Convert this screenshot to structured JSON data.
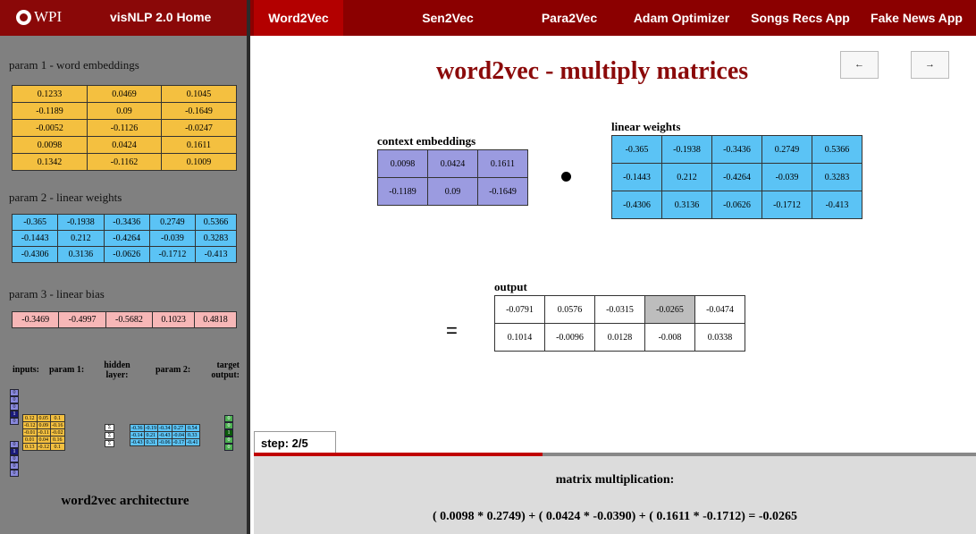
{
  "nav": {
    "logo": "WPI",
    "home": "visNLP 2.0 Home",
    "items": [
      "Word2Vec",
      "Sen2Vec",
      "Para2Vec",
      "Adam Optimizer",
      "Songs Recs App",
      "Fake News App"
    ],
    "active": "Word2Vec"
  },
  "sidebar": {
    "param1_label": "param 1 - word embeddings",
    "param1": [
      [
        "0.1233",
        "0.0469",
        "0.1045"
      ],
      [
        "-0.1189",
        "0.09",
        "-0.1649"
      ],
      [
        "-0.0052",
        "-0.1126",
        "-0.0247"
      ],
      [
        "0.0098",
        "0.0424",
        "0.1611"
      ],
      [
        "0.1342",
        "-0.1162",
        "0.1009"
      ]
    ],
    "param2_label": "param 2 - linear weights",
    "param2": [
      [
        "-0.365",
        "-0.1938",
        "-0.3436",
        "0.2749",
        "0.5366"
      ],
      [
        "-0.1443",
        "0.212",
        "-0.4264",
        "-0.039",
        "0.3283"
      ],
      [
        "-0.4306",
        "0.3136",
        "-0.0626",
        "-0.1712",
        "-0.413"
      ]
    ],
    "param3_label": "param 3 - linear bias",
    "param3": [
      [
        "-0.3469",
        "-0.4997",
        "-0.5682",
        "0.1023",
        "0.4818"
      ]
    ],
    "arch": {
      "inputs": "inputs:",
      "param1": "param 1:",
      "hidden": "hidden layer:",
      "param2": "param 2:",
      "target": "target output:",
      "input_vec_top": [
        "0",
        "0",
        "0",
        "1",
        "0"
      ],
      "input_vec_bottom": [
        "0",
        "1",
        "0",
        "0",
        "0"
      ],
      "mini_p1": [
        [
          "0.12",
          "0.05",
          "0.1"
        ],
        [
          "-0.12",
          "0.09",
          "-0.16"
        ],
        [
          "-0.01",
          "-0.11",
          "-0.02"
        ],
        [
          "0.01",
          "0.04",
          "0.16"
        ],
        [
          "0.13",
          "-0.12",
          "0.1"
        ]
      ],
      "sigma": [
        "Σ",
        "Σ",
        "Σ"
      ],
      "mini_p2": [
        [
          "-0.36",
          "-0.19",
          "-0.34",
          "0.27",
          "0.54"
        ],
        [
          "-0.14",
          "0.21",
          "-0.43",
          "-0.04",
          "0.33"
        ],
        [
          "-0.43",
          "0.31",
          "-0.06",
          "-0.17",
          "-0.41"
        ]
      ],
      "target_vec": [
        "0",
        "0",
        "1",
        "0",
        "0"
      ],
      "title": "word2vec architecture"
    }
  },
  "main": {
    "title": "word2vec - multiply matrices",
    "prev_label": "←",
    "next_label": "→",
    "context_label": "context embeddings",
    "context": [
      [
        "0.0098",
        "0.0424",
        "0.1611"
      ],
      [
        "-0.1189",
        "0.09",
        "-0.1649"
      ]
    ],
    "weights_label": "linear weights",
    "weights": [
      [
        "-0.365",
        "-0.1938",
        "-0.3436",
        "0.2749",
        "0.5366"
      ],
      [
        "-0.1443",
        "0.212",
        "-0.4264",
        "-0.039",
        "0.3283"
      ],
      [
        "-0.4306",
        "0.3136",
        "-0.0626",
        "-0.1712",
        "-0.413"
      ]
    ],
    "equals": "=",
    "output_label": "output",
    "output": [
      [
        "-0.0791",
        "0.0576",
        "-0.0315",
        "-0.0265",
        "-0.0474"
      ],
      [
        "0.1014",
        "-0.0096",
        "0.0128",
        "-0.008",
        "0.0338"
      ]
    ],
    "highlight_cell": [
      0,
      3
    ],
    "step_label": "step: 2/5",
    "progress": 0.4,
    "mm_label": "matrix multiplication:",
    "mm_formula": "( 0.0098 * 0.2749) + ( 0.0424 * -0.0390) + ( 0.1611 * -0.1712) = -0.0265"
  }
}
